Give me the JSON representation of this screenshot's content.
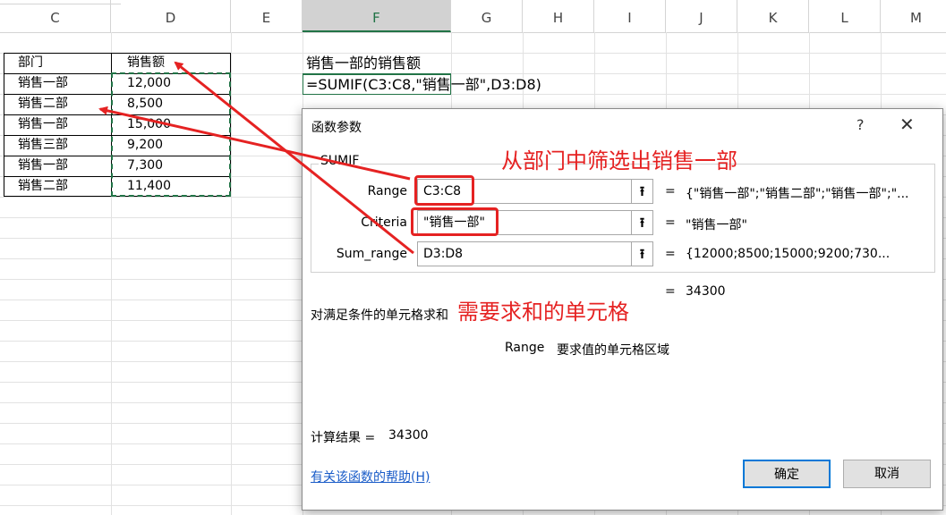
{
  "spreadsheet": {
    "columns": [
      "C",
      "D",
      "E",
      "F",
      "G",
      "H",
      "I",
      "J",
      "K",
      "L",
      "M"
    ],
    "selected_column": "F",
    "table": {
      "headers": [
        "部门",
        "销售额"
      ],
      "rows": [
        [
          "销售一部",
          "12,000"
        ],
        [
          "销售二部",
          "8,500"
        ],
        [
          "销售一部",
          "15,000"
        ],
        [
          "销售三部",
          "9,200"
        ],
        [
          "销售一部",
          "7,300"
        ],
        [
          "销售二部",
          "11,400"
        ]
      ]
    },
    "f2_text": "销售一部的销售额",
    "f3_formula": "=SUMIF(C3:C8,\"销售一部\",D3:D8)"
  },
  "dialog": {
    "title": "函数参数",
    "help_icon": "?",
    "close_icon": "✕",
    "function_name": "SUMIF",
    "args": [
      {
        "label": "Range",
        "value": "C3:C8",
        "result": "{\"销售一部\";\"销售二部\";\"销售一部\";\"..."
      },
      {
        "label": "Criteria",
        "value": "\"销售一部\"",
        "result": "\"销售一部\""
      },
      {
        "label": "Sum_range",
        "value": "D3:D8",
        "result": "{12000;8500;15000;9200;730..."
      }
    ],
    "equals": "=",
    "ref_icon": "⭱",
    "formula_result": "34300",
    "description": "对满足条件的单元格求和",
    "arg_desc_name": "Range",
    "arg_desc_text": "要求值的单元格区域",
    "calc_label": "计算结果 =",
    "calc_value": "34300",
    "help_link": "有关该函数的帮助(H)",
    "ok_label": "确定",
    "cancel_label": "取消"
  },
  "annotations": {
    "range_note": "从部门中筛选出销售一部",
    "sum_note": "需要求和的单元格",
    "color": "#e52222"
  },
  "colors": {
    "excel_green": "#217346",
    "link_blue": "#1a5cc8",
    "accent": "#0078d7"
  }
}
